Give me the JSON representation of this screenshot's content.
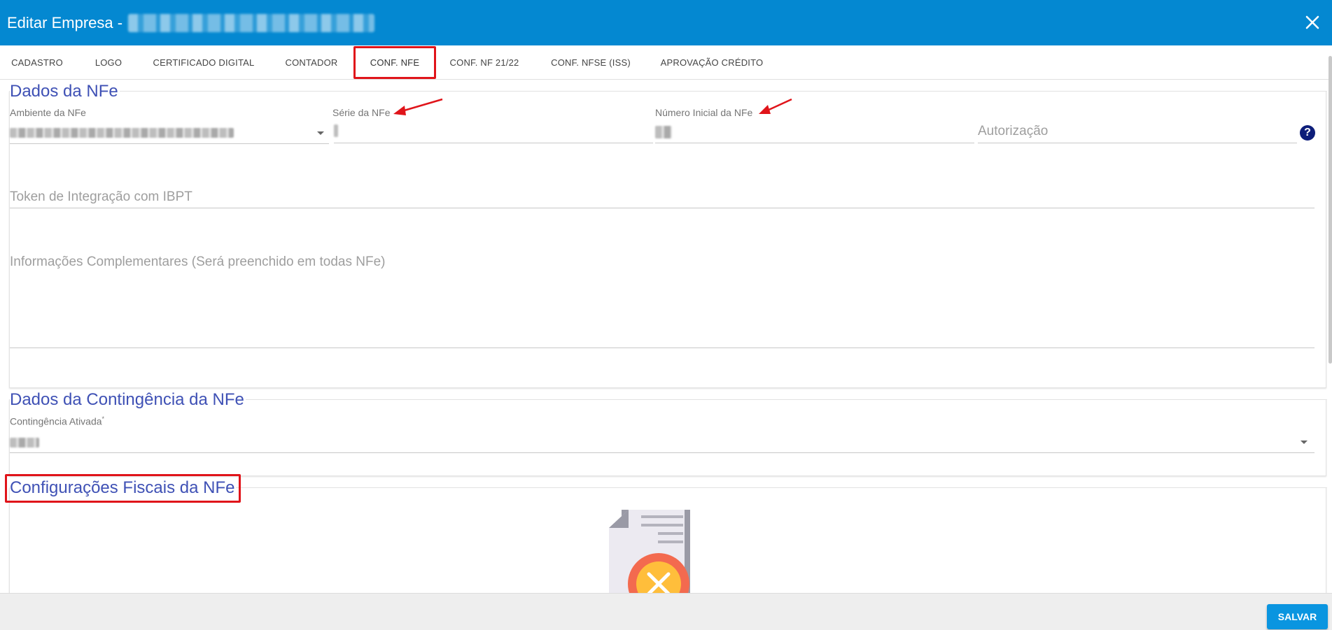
{
  "header": {
    "title": "Editar Empresa -",
    "close_icon": "close-icon"
  },
  "tabs": [
    {
      "label": "CADASTRO"
    },
    {
      "label": "LOGO"
    },
    {
      "label": "CERTIFICADO DIGITAL"
    },
    {
      "label": "CONTADOR"
    },
    {
      "label": "CONF. NFE",
      "active": true
    },
    {
      "label": "CONF. NF 21/22"
    },
    {
      "label": "CONF. NFSE (ISS)"
    },
    {
      "label": "APROVAÇÃO CRÉDITO"
    }
  ],
  "nfe": {
    "title": "Dados da NFe",
    "ambiente_label": "Ambiente da NFe",
    "serie_label": "Série da NFe",
    "numero_label": "Número Inicial da NFe",
    "autorizacao_placeholder": "Autorização",
    "token_placeholder": "Token de Integração com IBPT",
    "info_placeholder": "Informações Complementares (Será preenchido em todas NFe)",
    "help_icon_text": "?"
  },
  "contingencia": {
    "title": "Dados da Contingência da NFe",
    "ativada_label": "Contingência Ativada",
    "required_mark": "*"
  },
  "fiscais": {
    "title": "Configurações Fiscais da NFe",
    "empty_icon": "document-error-icon"
  },
  "footer": {
    "save_label": "SALVAR"
  },
  "colors": {
    "header": "#0488d1",
    "section_title": "#3f51b5",
    "annotation": "#e0141a",
    "save": "#0a95e0"
  }
}
